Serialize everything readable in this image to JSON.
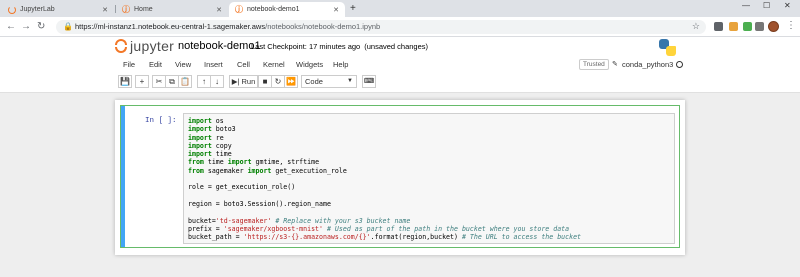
{
  "browser": {
    "tabs": [
      {
        "label": "JupyterLab",
        "icon": "jupyterlab-icon"
      },
      {
        "label": "Home",
        "icon": "jupyter-icon"
      },
      {
        "label": "notebook-demo1",
        "icon": "jupyter-icon",
        "active": true
      }
    ],
    "url_host": "https://ml-instanz1.notebook.eu-central-1.sagemaker.aws",
    "url_path": "/notebooks/notebook-demo1.ipynb"
  },
  "header": {
    "logo_text": "jupyter",
    "notebook_name": "notebook-demo1",
    "checkpoint": "Last Checkpoint: 17 minutes ago",
    "save_status": "(unsaved changes)"
  },
  "menubar": {
    "items": [
      "File",
      "Edit",
      "View",
      "Insert",
      "Cell",
      "Kernel",
      "Widgets",
      "Help"
    ],
    "trusted": "Trusted",
    "kernel": "conda_python3"
  },
  "toolbar": {
    "run_label": "Run",
    "cell_type": "Code"
  },
  "cell": {
    "prompt": "In [ ]:",
    "lines": [
      [
        {
          "k": "import"
        },
        {
          "t": " os"
        }
      ],
      [
        {
          "k": "import"
        },
        {
          "t": " boto3"
        }
      ],
      [
        {
          "k": "import"
        },
        {
          "t": " re"
        }
      ],
      [
        {
          "k": "import"
        },
        {
          "t": " copy"
        }
      ],
      [
        {
          "k": "import"
        },
        {
          "t": " time"
        }
      ],
      [
        {
          "k": "from"
        },
        {
          "t": " time "
        },
        {
          "k": "import"
        },
        {
          "t": " gmtime, strftime"
        }
      ],
      [
        {
          "k": "from"
        },
        {
          "t": " sagemaker "
        },
        {
          "k": "import"
        },
        {
          "t": " get_execution_role"
        }
      ],
      [],
      [
        {
          "t": "role = get_execution_role()"
        }
      ],
      [],
      [
        {
          "t": "region = boto3.Session().region_name"
        }
      ],
      [],
      [
        {
          "t": "bucket="
        },
        {
          "s": "'td-sagemaker'"
        },
        {
          "t": " "
        },
        {
          "c": "# Replace with your s3 bucket name"
        }
      ],
      [
        {
          "t": "prefix = "
        },
        {
          "s": "'sagemaker/xgboost-mnist'"
        },
        {
          "t": " "
        },
        {
          "c": "# Used as part of the path in the bucket where you store data"
        }
      ],
      [
        {
          "t": "bucket_path = "
        },
        {
          "s": "'https://s3-{}.amazonaws.com/{}'"
        },
        {
          "t": ".format(region,bucket) "
        },
        {
          "c": "# The URL to access the bucket"
        }
      ]
    ]
  }
}
